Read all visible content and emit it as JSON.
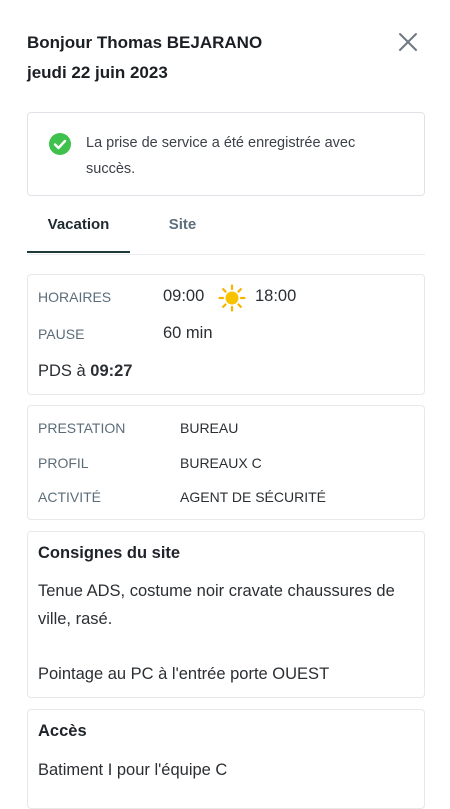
{
  "header": {
    "greeting": "Bonjour Thomas BEJARANO",
    "date": "jeudi 22 juin 2023",
    "close_icon": "close-icon"
  },
  "alert": {
    "icon": "check-circle-icon",
    "message": "La prise de service a été enregistrée avec succès.",
    "color": "#3fc14d"
  },
  "tabs": [
    {
      "label": "Vacation",
      "active": true
    },
    {
      "label": "Site",
      "active": false
    }
  ],
  "schedule": {
    "horaires_label": "HORAIRES",
    "start": "09:00",
    "end": "18:00",
    "shift_icon": "sun-icon",
    "pause_label": "PAUSE",
    "pause_value": "60 min",
    "pds_prefix": "PDS à",
    "pds_time": "09:27"
  },
  "details": {
    "prestation_label": "PRESTATION",
    "prestation_value": "BUREAU",
    "profil_label": "PROFIL",
    "profil_value": "BUREAUX C",
    "activite_label": "ACTIVITÉ",
    "activite_value": "AGENT DE SÉCURITÉ"
  },
  "consignes": {
    "title": "Consignes du site",
    "line1": "Tenue ADS, costume noir cravate chaussures de ville, rasé.",
    "line2": "Pointage au PC à l'entrée porte OUEST"
  },
  "acces": {
    "title": "Accès",
    "text": "Batiment I pour l'équipe C"
  }
}
